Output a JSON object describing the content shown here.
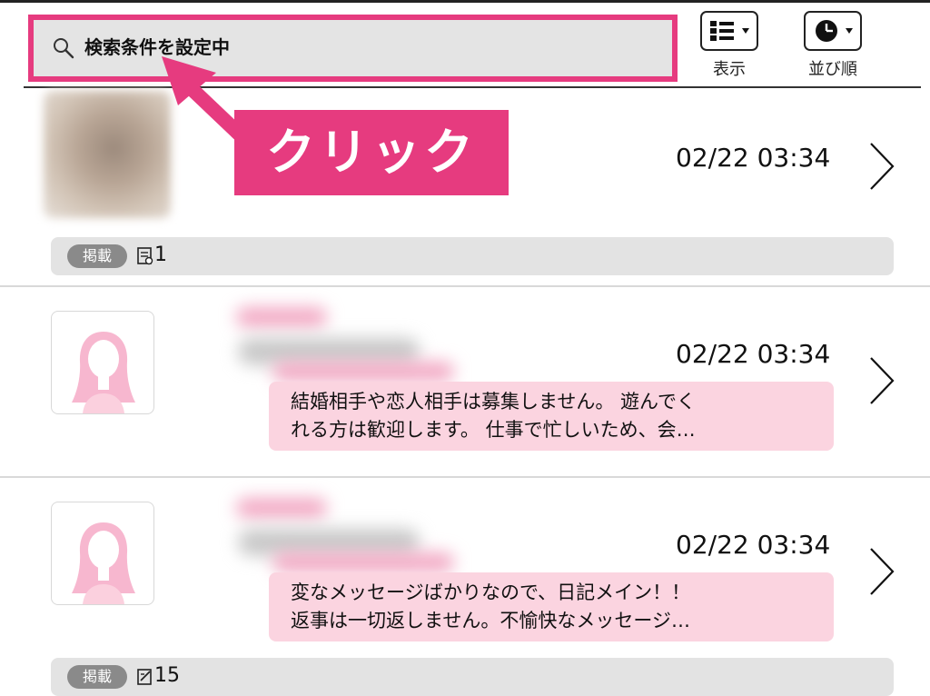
{
  "header": {
    "search_text": "検索条件を設定中",
    "view_label": "表示",
    "sort_label": "並び順"
  },
  "annotation": {
    "label": "クリック",
    "accent_color": "#e63b7f"
  },
  "items": [
    {
      "timestamp": "02/22 03:34",
      "tag": "掲載",
      "tag_icon": "document-icon",
      "count": "1"
    },
    {
      "timestamp": "02/22 03:34",
      "message_line1": "結婚相手や恋人相手は募集しません。 遊んでく",
      "message_line2": "れる方は歓迎します。 仕事で忙しいため、会…"
    },
    {
      "timestamp": "02/22 03:34",
      "message_line1": "変なメッセージばかりなので、日記メイン！！",
      "message_line2": "返事は一切返しません。不愉快なメッセージ…",
      "tag": "掲載",
      "tag_icon": "diary-edit-icon",
      "count": "15"
    }
  ]
}
